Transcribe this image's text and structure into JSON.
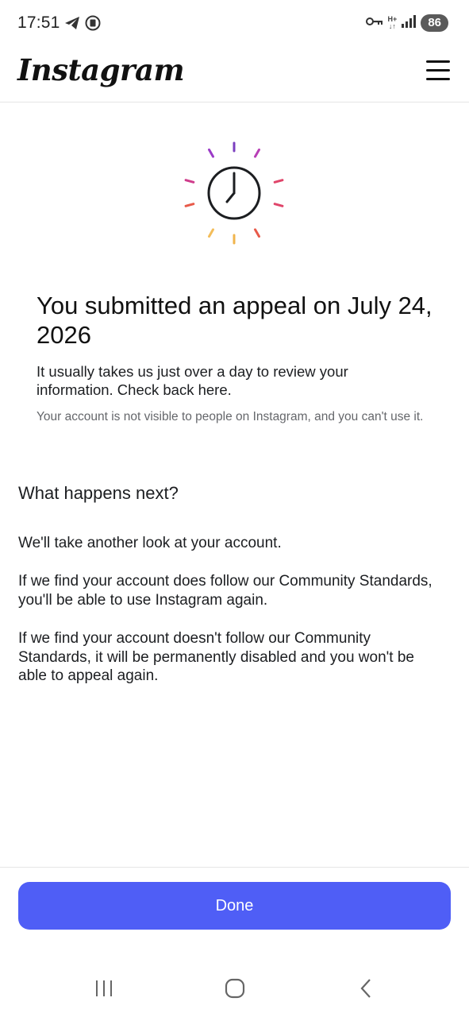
{
  "status_bar": {
    "time": "17:51",
    "network_type": "H+",
    "battery": "86",
    "icons": [
      "telegram-icon",
      "sync-icon",
      "vpn-key-icon",
      "signal-icon"
    ]
  },
  "header": {
    "logo": "Instagram",
    "menu_icon": "hamburger-menu-icon"
  },
  "hero": {
    "icon": "clock-icon",
    "ray_colors": [
      "#7b3fbf",
      "#9b3bc7",
      "#b83fb6",
      "#cf3d8c",
      "#e0456a",
      "#e85a4a",
      "#f3bd5a",
      "#f0b44c"
    ]
  },
  "main": {
    "title": "You submitted an appeal on July 24, 2026",
    "info": "It usually takes us just over a day to review your information. Check back here.",
    "note": "Your account is not visible to people on Instagram, and you can't use it."
  },
  "next": {
    "heading": "What happens next?",
    "p1": "We'll take another look at your account.",
    "p2": "If we find your account does follow our Community Standards, you'll be able to use Instagram again.",
    "p3": "If we find your account doesn't follow our Community Standards, it will be permanently disabled and you won't be able to appeal again."
  },
  "footer": {
    "done_label": "Done",
    "accent": "#4f5ef6"
  },
  "nav": {
    "recents_icon": "recents-icon",
    "home_icon": "home-icon",
    "back_icon": "back-icon"
  }
}
